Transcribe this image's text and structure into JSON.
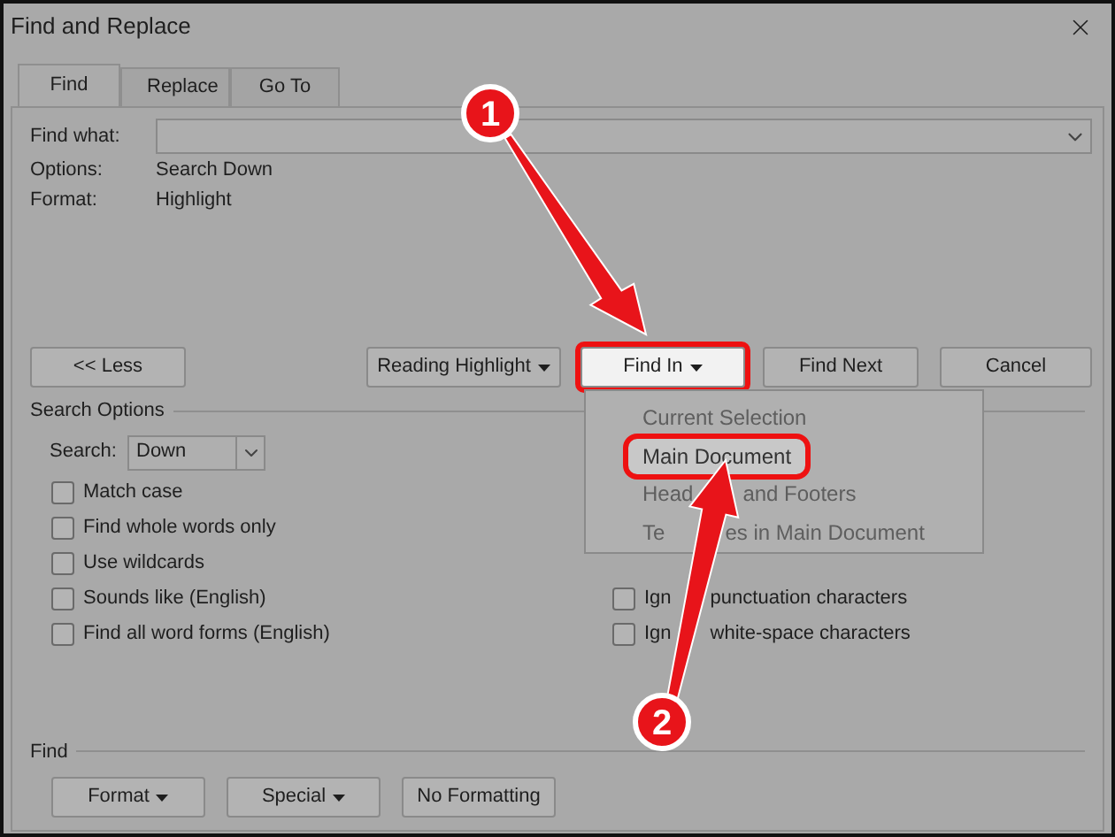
{
  "window": {
    "title": "Find and Replace"
  },
  "tabs": [
    {
      "label": "Find",
      "selected": true
    },
    {
      "label": "Replace",
      "selected": false
    },
    {
      "label": "Go To",
      "selected": false
    }
  ],
  "find_what": {
    "label": "Find what:"
  },
  "info": [
    {
      "label": "Options:",
      "value": "Search Down"
    },
    {
      "label": "Format:",
      "value": "Highlight"
    }
  ],
  "buttons": [
    {
      "label": "<< Less",
      "dropdown": false,
      "highlighted": false
    },
    {
      "label": "Reading Highlight",
      "dropdown": true,
      "highlighted": false
    },
    {
      "label": "Find In",
      "dropdown": true,
      "highlighted": true
    },
    {
      "label": "Find Next",
      "dropdown": false,
      "highlighted": false
    },
    {
      "label": "Cancel",
      "dropdown": false,
      "highlighted": false
    }
  ],
  "search_options": {
    "title": "Search Options",
    "search_label": "Search:",
    "search_value": "Down",
    "left": [
      {
        "parts": [
          "Match case"
        ],
        "checked": false
      },
      {
        "parts": [
          "Find whole words only"
        ],
        "checked": false
      },
      {
        "parts": [
          "Use wildcards"
        ],
        "checked": false
      },
      {
        "parts": [
          "Sounds like (English)"
        ],
        "checked": false
      },
      {
        "parts": [
          "Find all word forms (English)"
        ],
        "checked": false
      }
    ],
    "right": [
      {
        "parts": [
          "Ign",
          "punctuation characters"
        ],
        "checked": false
      },
      {
        "parts": [
          "Ign",
          "white-space characters"
        ],
        "checked": false
      }
    ]
  },
  "menu": {
    "items": [
      {
        "parts": [
          "Current Selection"
        ],
        "selected": false
      },
      {
        "parts": [
          "Main Document"
        ],
        "selected": true
      },
      {
        "parts": [
          "Head",
          "and Footers"
        ],
        "selected": false
      },
      {
        "parts": [
          "Te",
          "es in Main Document"
        ],
        "selected": false
      }
    ]
  },
  "find_section": {
    "title": "Find",
    "buttons": [
      {
        "label": "Format",
        "dropdown": true
      },
      {
        "label": "Special",
        "dropdown": true
      },
      {
        "label": "No Formatting",
        "dropdown": false
      }
    ]
  },
  "callouts": [
    "1",
    "2"
  ]
}
